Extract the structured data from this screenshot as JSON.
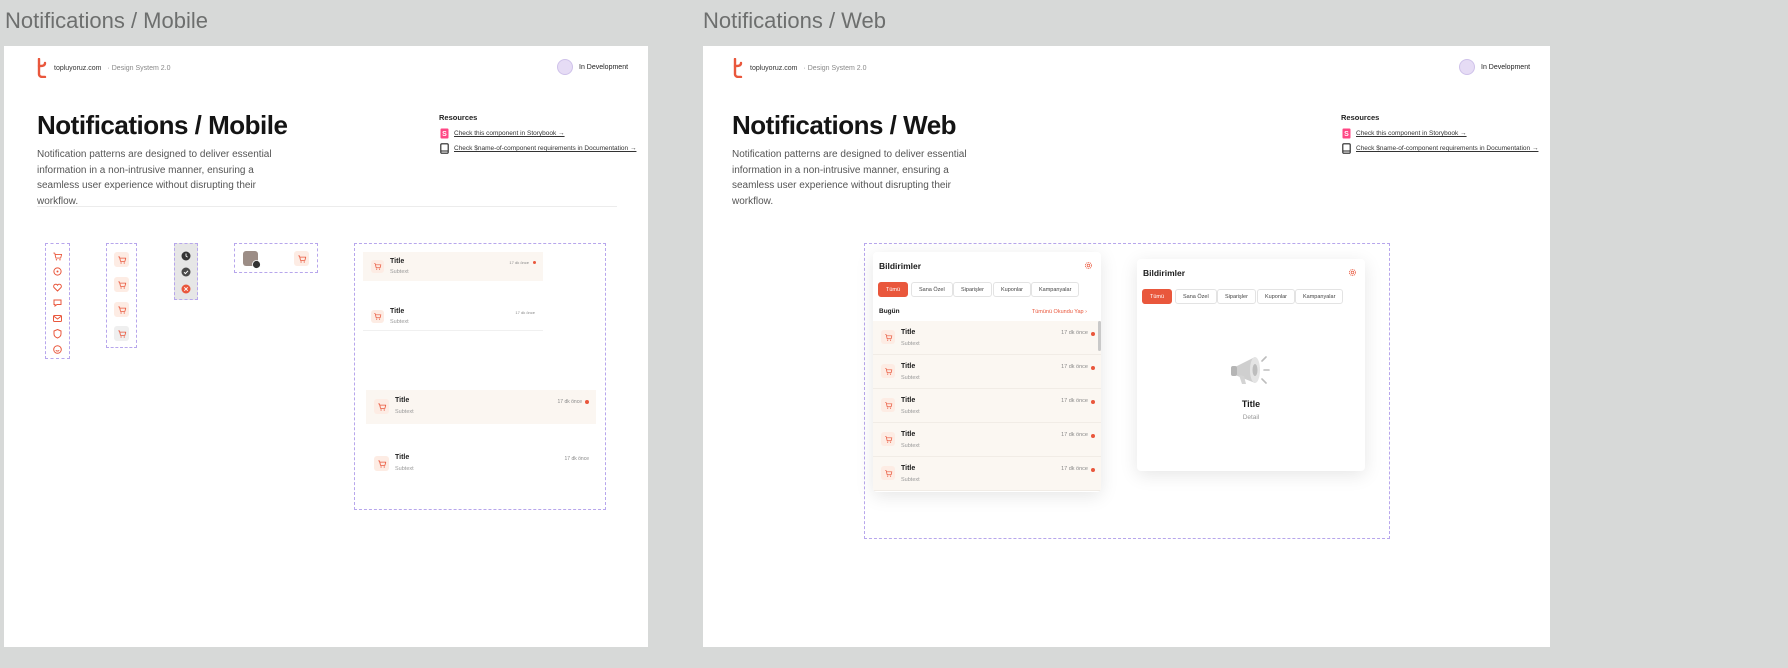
{
  "frames": [
    {
      "label": "Notifications / Mobile",
      "brand": "topluyoruz.com",
      "brand_sub": "· Design System 2.0",
      "status": "In Development",
      "title": "Notifications / Mobile",
      "description": "Notification patterns are designed to deliver essential information in a non-intrusive manner, ensuring a seamless user experience without disrupting their workflow.",
      "resources_title": "Resources",
      "resources": [
        "Check this component in Storybook →",
        "Check $name-of-component requirements in Documentation →"
      ]
    },
    {
      "label": "Notifications / Web",
      "brand": "topluyoruz.com",
      "brand_sub": "· Design System 2.0",
      "status": "In Development",
      "title": "Notifications / Web",
      "description": "Notification patterns are designed to deliver essential information in a non-intrusive manner, ensuring a seamless user experience without disrupting their workflow.",
      "resources_title": "Resources",
      "resources": [
        "Check this component in Storybook →",
        "Check $name-of-component requirements in Documentation →"
      ]
    }
  ],
  "mobile_notifs": [
    {
      "title": "Title",
      "subtitle": "Subtext",
      "time": "17 dk önce",
      "unread": true
    },
    {
      "title": "Title",
      "subtitle": "Subtext",
      "time": "17 dk önce",
      "unread": false
    },
    {
      "title": "Title",
      "subtitle": "Subtext",
      "time": "17 dk önce",
      "unread": true
    },
    {
      "title": "Title",
      "subtitle": "Subtext",
      "time": "17 dk önce",
      "unread": false
    }
  ],
  "web_panel": {
    "title": "Bildirimler",
    "tabs": [
      "Tümü",
      "Sana Özel",
      "Siparişler",
      "Kuponlar",
      "Kampanyalar"
    ],
    "section": "Bugün",
    "mark_all": "Tümünü Okundu Yap",
    "items": [
      {
        "title": "Title",
        "subtitle": "Subtext",
        "time": "17 dk önce"
      },
      {
        "title": "Title",
        "subtitle": "Subtext",
        "time": "17 dk önce"
      },
      {
        "title": "Title",
        "subtitle": "Subtext",
        "time": "17 dk önce"
      },
      {
        "title": "Title",
        "subtitle": "Subtext",
        "time": "17 dk önce"
      },
      {
        "title": "Title",
        "subtitle": "Subtext",
        "time": "17 dk önce"
      }
    ]
  },
  "web_empty": {
    "title": "Bildirimler",
    "tabs": [
      "Tümü",
      "Sana Özel",
      "Siparişler",
      "Kuponlar",
      "Kampanyalar"
    ],
    "empty_title": "Title",
    "empty_detail": "Detail"
  },
  "colors": {
    "accent": "#e9573c",
    "dashed": "#b7a6ec",
    "row_unread": "#fbf7f2"
  },
  "icons": {
    "cart": "cart-icon",
    "settings": "gear-icon",
    "megaphone": "megaphone-icon",
    "storybook": "storybook-icon",
    "docs": "book-icon"
  }
}
